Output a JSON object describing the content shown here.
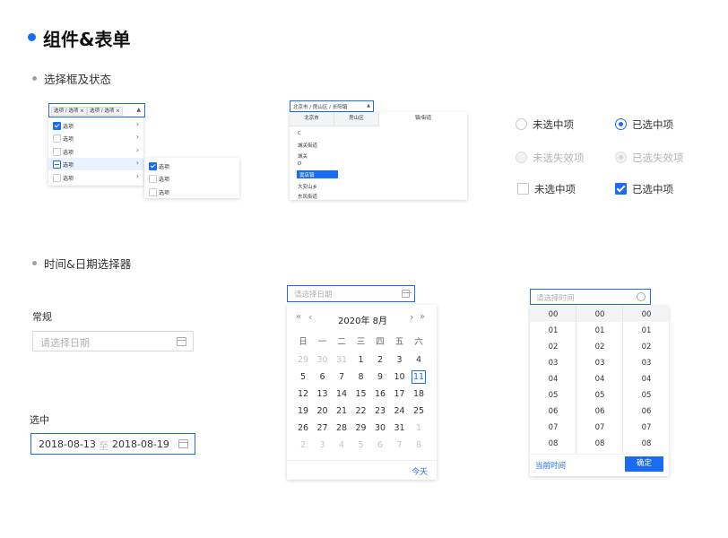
{
  "page_title": "组件&表单",
  "sections": {
    "select": "选择框及状态",
    "time": "时间&日期选择器"
  },
  "multi_select": {
    "tags": [
      "选项 / 选项",
      "选项 / 选项"
    ],
    "list": [
      "选项",
      "选项",
      "选项",
      "选项",
      "选项"
    ],
    "submenu": [
      "选项",
      "选项",
      "选项"
    ]
  },
  "region": {
    "value": "北京市 / 房山区 / 长阳镇",
    "tabs": [
      "北京市",
      "房山区",
      "镇/街道"
    ],
    "items": [
      "C",
      "城关街道",
      "城关",
      "D",
      "窦店镇",
      "大安山乡",
      "东风街道"
    ],
    "selected_index": 4
  },
  "radios": {
    "unselected": "未选中项",
    "selected": "已选中项",
    "unselected_disabled": "未选失效项",
    "selected_disabled": "已选失效项"
  },
  "checkboxes": {
    "unchecked": "未选中项",
    "checked": "已选中项"
  },
  "date_normal": {
    "label": "常规",
    "placeholder": "请选择日期"
  },
  "date_range": {
    "label": "选中",
    "start": "2018-08-13",
    "sep": "至",
    "end": "2018-08-19"
  },
  "calendar": {
    "placeholder": "请选择日期",
    "month_title": "2020年 8月",
    "nav": {
      "prev_year": "«",
      "prev_month": "‹",
      "next_month": "›",
      "next_year": "»"
    },
    "weekdays": [
      "日",
      "一",
      "二",
      "三",
      "四",
      "五",
      "六"
    ],
    "weeks": [
      [
        "29",
        "30",
        "31",
        "1",
        "2",
        "3",
        "4"
      ],
      [
        "5",
        "6",
        "7",
        "8",
        "9",
        "10",
        "11"
      ],
      [
        "12",
        "13",
        "14",
        "15",
        "16",
        "17",
        "18"
      ],
      [
        "19",
        "20",
        "21",
        "22",
        "23",
        "24",
        "25"
      ],
      [
        "26",
        "27",
        "28",
        "29",
        "30",
        "31",
        "1"
      ],
      [
        "2",
        "3",
        "4",
        "5",
        "6",
        "7",
        "8"
      ]
    ],
    "today_button": "今天",
    "selected_day": "11"
  },
  "time_picker": {
    "placeholder": "请选择时间",
    "hours": [
      "00",
      "01",
      "02",
      "03",
      "04",
      "05",
      "06",
      "07",
      "08"
    ],
    "minutes": [
      "00",
      "01",
      "02",
      "03",
      "04",
      "05",
      "06",
      "07",
      "08"
    ],
    "seconds": [
      "00",
      "01",
      "02",
      "03",
      "04",
      "05",
      "06",
      "07",
      "08"
    ],
    "now_button": "当前时间",
    "confirm_button": "确定"
  },
  "colors": {
    "accent": "#1a6cf3",
    "border": "#d9d9d9",
    "disabled": "#b4b4b4"
  }
}
